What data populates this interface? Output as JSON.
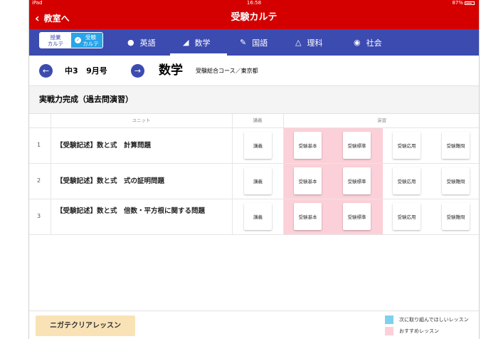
{
  "status": {
    "carrier": "iPad",
    "time": "16:58",
    "battery": "87%"
  },
  "header": {
    "back_label": "教室へ",
    "title": "受験カルテ"
  },
  "segment": {
    "left_label": "授業\nカルテ",
    "right_label": "受験\nカルテ"
  },
  "tabs": [
    {
      "label": "英語",
      "icon": "apple-icon"
    },
    {
      "label": "数学",
      "icon": "triangle-ruler-icon",
      "active": true
    },
    {
      "label": "国語",
      "icon": "pencil-icon"
    },
    {
      "label": "理科",
      "icon": "flask-icon"
    },
    {
      "label": "社会",
      "icon": "globe-icon"
    }
  ],
  "subheader": {
    "grade": "中3",
    "month": "9月号",
    "subject": "数学",
    "course": "受験総合コース／東京都"
  },
  "section_title": "実戦力完成（過去問演習）",
  "table": {
    "col_unit": "ユニット",
    "col_lecture": "講義",
    "col_practice": "演習",
    "rows": [
      {
        "num": "1",
        "unit": "【受験記述】数と式　計算問題",
        "lecture": "講義",
        "b1": "受験基本",
        "b2": "受験標準",
        "b3": "受験応用",
        "b4": "受験難問"
      },
      {
        "num": "2",
        "unit": "【受験記述】数と式　式の証明問題",
        "lecture": "講義",
        "b1": "受験基本",
        "b2": "受験標準",
        "b3": "受験応用",
        "b4": "受験難問"
      },
      {
        "num": "3",
        "unit": "【受験記述】数と式　倍数・平方根に関する問題",
        "lecture": "講義",
        "b1": "受験基本",
        "b2": "受験標準",
        "b3": "受験応用",
        "b4": "受験難問"
      }
    ]
  },
  "footer": {
    "easy_button": "ニガテクリアレッスン",
    "legend_next": "次に取り組んでほしいレッスン",
    "legend_recommended": "おすすめレッスン"
  },
  "colors": {
    "header_red": "#d40000",
    "tab_blue": "#3c4bb0",
    "next_blue": "#7fd0ee",
    "recommended_pink": "#fcd0d8"
  }
}
